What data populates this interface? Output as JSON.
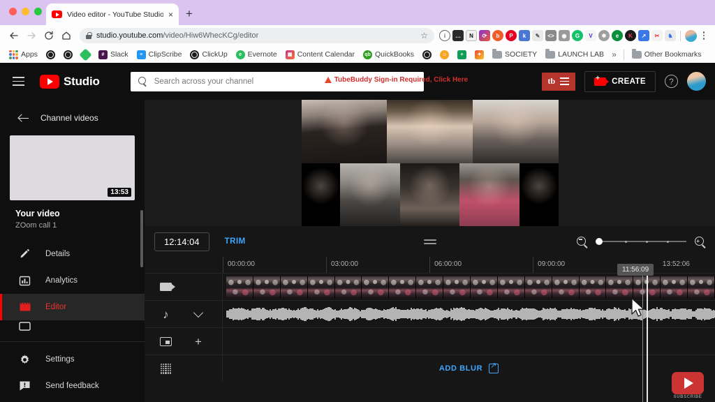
{
  "browser": {
    "tab": {
      "title": "Video editor - YouTube Studio",
      "favicon": "youtube-icon",
      "close": "×"
    },
    "new_tab_label": "+",
    "nav": {
      "back": "back-icon",
      "forward": "forward-icon",
      "reload": "reload-icon",
      "home": "home-icon"
    },
    "url": {
      "domain": "studio.youtube.com",
      "path": "/video/Hiw6WhecKCg/editor",
      "lock": "lock-icon",
      "star": "☆"
    },
    "extensions": [
      "info-icon",
      "dots-icon",
      "notion-icon",
      "refresh-ext-icon",
      "b-icon",
      "pinterest-icon",
      "keyword-icon",
      "eyedropper-icon",
      "code-icon",
      "camera-icon",
      "grammarly-icon",
      "vidiq-icon",
      "gear-ext-icon",
      "evernote-green-icon",
      "kit-icon",
      "expand-icon",
      "scissors-icon",
      "bird-icon"
    ],
    "profile": "profile-avatar",
    "menu": "chrome-menu-icon",
    "bookmarks": [
      {
        "label": "Apps",
        "icon": "apps-grid-icon"
      },
      {
        "label": "",
        "icon": "globe-icon"
      },
      {
        "label": "",
        "icon": "globe-icon"
      },
      {
        "label": "",
        "icon": "evernote-icon"
      },
      {
        "label": "Slack",
        "icon": "slack-icon"
      },
      {
        "label": "ClipScribe",
        "icon": "clipscribe-icon"
      },
      {
        "label": "ClickUp",
        "icon": "globe-icon"
      },
      {
        "label": "Evernote",
        "icon": "evernote-icon"
      },
      {
        "label": "Content Calendar",
        "icon": "calendar-icon"
      },
      {
        "label": "QuickBooks",
        "icon": "quickbooks-icon"
      },
      {
        "label": "",
        "icon": "globe-icon"
      },
      {
        "label": "",
        "icon": "smiley-icon"
      },
      {
        "label": "",
        "icon": "sheets-icon"
      },
      {
        "label": "",
        "icon": "paint-icon"
      },
      {
        "label": "SOCIETY",
        "icon": "folder-icon"
      },
      {
        "label": "LAUNCH LAB",
        "icon": "folder-icon"
      }
    ],
    "bookmarks_overflow": "»",
    "other_bookmarks": {
      "label": "Other Bookmarks",
      "icon": "folder-icon"
    }
  },
  "studio_header": {
    "menu_icon": "hamburger-icon",
    "logo_text": "Studio",
    "search_placeholder": "Search across your channel",
    "search_icon": "search-icon",
    "tubebuddy_warning": "TubeBuddy Sign-in Required, Click Here",
    "tubebuddy_button": "tb",
    "create_label": "CREATE",
    "help_icon": "help-icon",
    "avatar": "channel-avatar"
  },
  "sidebar": {
    "back_label": "Channel videos",
    "thumbnail_duration": "13:53",
    "video_title": "Your video",
    "video_subtitle": "ZOom call 1",
    "items": [
      {
        "label": "Details",
        "icon": "pencil-icon",
        "active": false
      },
      {
        "label": "Analytics",
        "icon": "bar-chart-icon",
        "active": false
      },
      {
        "label": "Editor",
        "icon": "editor-clapper-icon",
        "active": true
      },
      {
        "label": "",
        "icon": "subtitles-icon",
        "active": false
      }
    ],
    "bottom_items": [
      {
        "label": "Settings",
        "icon": "gear-icon"
      },
      {
        "label": "Send feedback",
        "icon": "feedback-icon"
      }
    ]
  },
  "editor": {
    "timecode": "12:14:04",
    "trim_label": "TRIM",
    "drag_handle": "drag-handle-icon",
    "zoom_out_icon": "zoom-out-icon",
    "zoom_in_icon": "zoom-in-icon",
    "zoom_level_percent": 0,
    "ruler_ticks": [
      "00:00:00",
      "03:00:00",
      "06:00:00",
      "09:00:00",
      "13:52:06"
    ],
    "playhead_tooltip": "11:56:09",
    "tracks": [
      {
        "name": "video-track",
        "icon": "video-camera-icon",
        "secondary_icon": ""
      },
      {
        "name": "audio-track",
        "icon": "music-note-icon",
        "secondary_icon": "chevron-down-icon"
      },
      {
        "name": "overlay-track",
        "icon": "pip-icon",
        "secondary_icon": "plus-icon"
      },
      {
        "name": "blur-track",
        "icon": "blur-grid-icon",
        "secondary_icon": ""
      }
    ],
    "add_blur_label": "ADD BLUR",
    "add_blur_icon": "external-link-icon",
    "subscribe_caption": "SUBSCRIBE",
    "cursor": "mouse-pointer"
  },
  "preview": {
    "participants": [
      "participant-1",
      "participant-2",
      "participant-3",
      "participant-4",
      "participant-5",
      "participant-6"
    ]
  },
  "colors": {
    "accent_blue": "#3ea6ff",
    "youtube_red": "#ff0000",
    "tubebuddy_red": "#b5352d",
    "warning_red": "#d32f2f",
    "tab_purple": "#dcc4f0",
    "studio_bg": "#0f0f0f"
  }
}
